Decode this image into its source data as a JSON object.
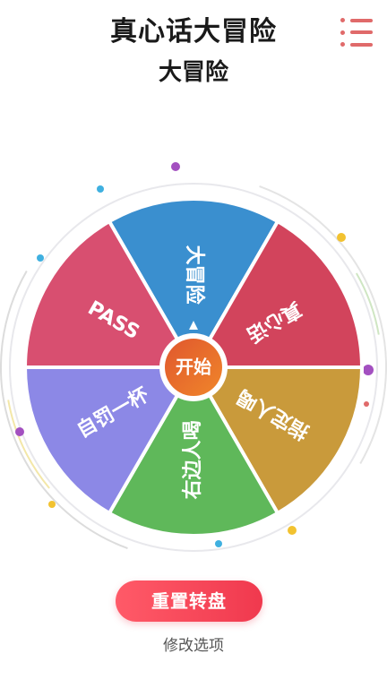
{
  "header": {
    "title": "真心话大冒险",
    "subtitle": "大冒险"
  },
  "menu": {
    "icon": "list-menu-icon"
  },
  "wheel": {
    "start_label": "开始",
    "segments": [
      {
        "label": "大冒险",
        "color": "#3a8fcf"
      },
      {
        "label": "真心话",
        "color": "#d2445c"
      },
      {
        "label": "指定人喝",
        "color": "#c99a3b"
      },
      {
        "label": "右边人喝",
        "color": "#5fb85a"
      },
      {
        "label": "自罚一杯",
        "color": "#8c88e6"
      },
      {
        "label": "PASS",
        "color": "#d84f70"
      }
    ],
    "center_color": "#ee6633",
    "pointer_icon": "triangle-pointer-icon"
  },
  "actions": {
    "reset_label": "重置转盘",
    "edit_label": "修改选项"
  },
  "colors": {
    "accent": "#f0394e",
    "menu": "#e06a6a"
  }
}
